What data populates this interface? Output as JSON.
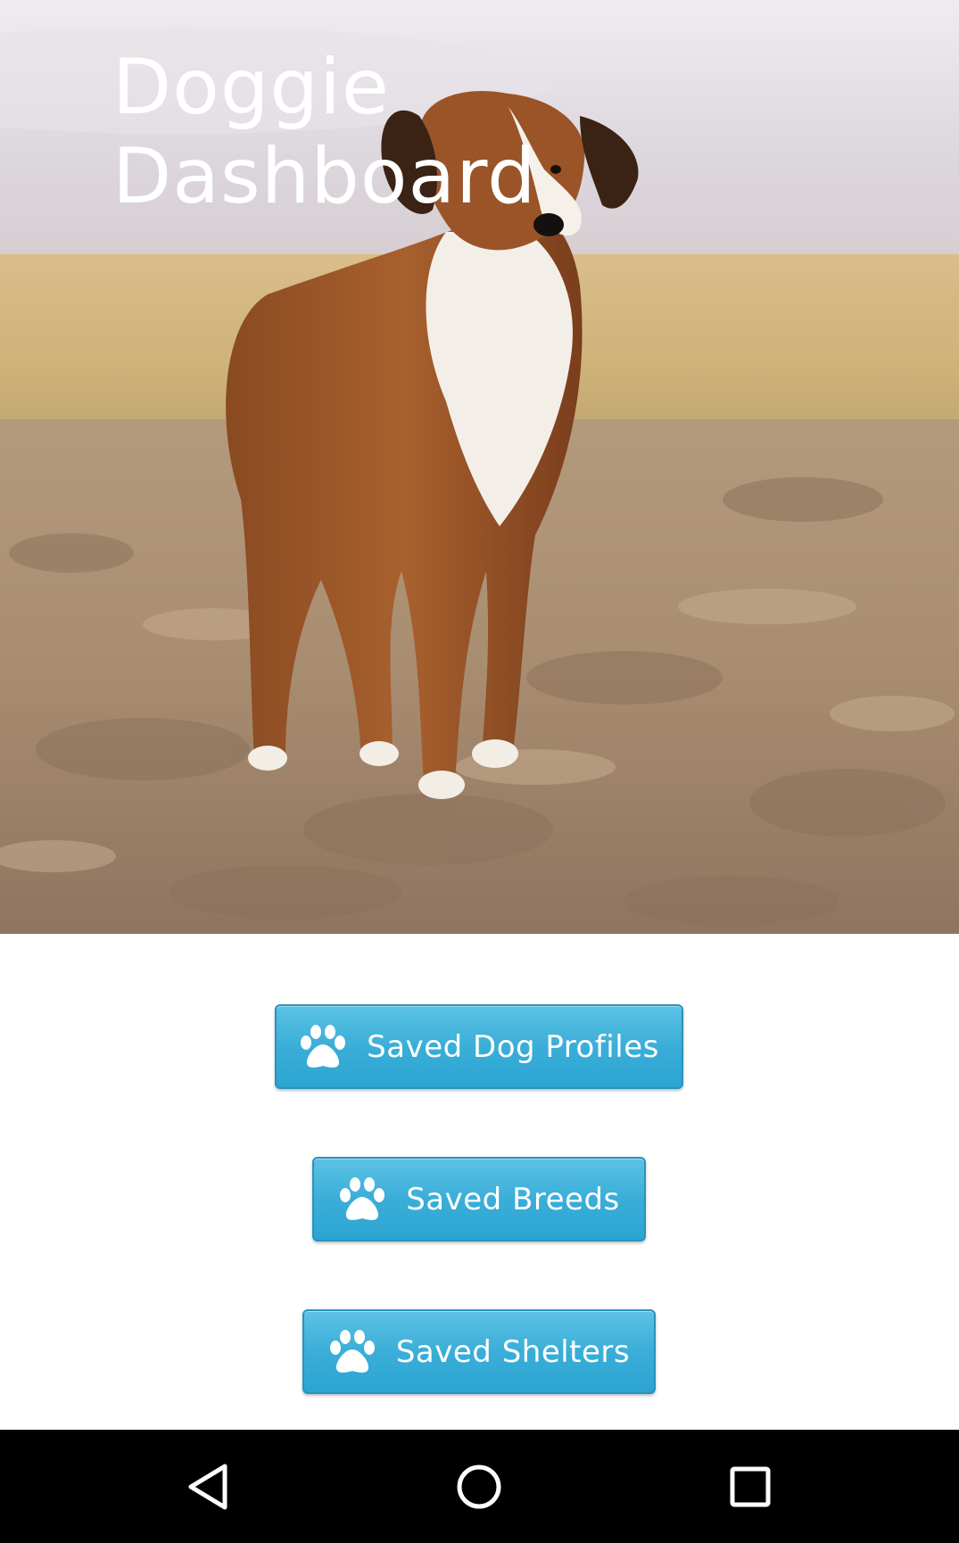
{
  "app": {
    "title_line1": "Doggie",
    "title_line2": "Dashboard"
  },
  "hero": {
    "image_subject": "dog standing in plowed field",
    "sky_color": "#dcd6dc",
    "grass_color": "#cdb07a",
    "soil_color": "#a68a6e"
  },
  "buttons": [
    {
      "label": "Saved Dog Profiles",
      "icon": "paw-icon"
    },
    {
      "label": "Saved Breeds",
      "icon": "paw-icon"
    },
    {
      "label": "Saved Shelters",
      "icon": "paw-icon"
    }
  ],
  "theme": {
    "button_color": "#3aaed8",
    "button_border": "#2a93be",
    "button_text": "#ffffff"
  },
  "navbar": {
    "back": "back-icon",
    "home": "home-icon",
    "recents": "recents-icon"
  }
}
